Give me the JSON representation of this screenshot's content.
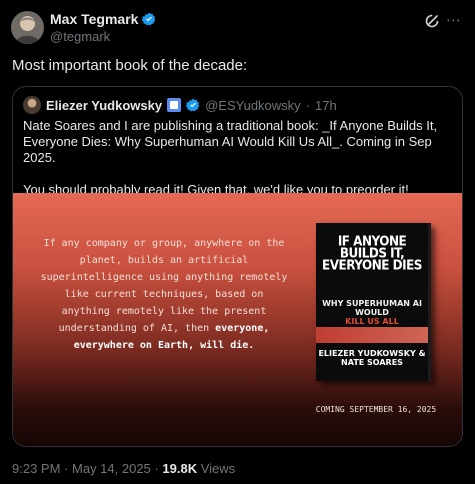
{
  "author": {
    "name": "Max Tegmark",
    "handle": "@tegmark"
  },
  "tweet_text": "Most important book of the decade:",
  "quoted": {
    "name": "Eliezer Yudkowsky",
    "handle": "@ESYudkowsky",
    "separator": "·",
    "time": "17h",
    "line1": "Nate Soares and I are publishing a traditional book:  _If Anyone Builds It, Everyone Dies: Why Superhuman AI Would Kill Us All_.  Coming in Sep 2025.",
    "line2": "You should probably read it!  Given that, we'd like you to preorder it!  Nowish!"
  },
  "image": {
    "quote_plain": "If any company or group, anywhere on the planet, builds an artificial superintelligence using anything remotely like current techniques, based on anything remotely like the present understanding of AI, then",
    "quote_bold": "everyone, everywhere on Earth, will die.",
    "book_title": "IF ANYONE BUILDS IT, EVERYONE DIES",
    "book_subtitle_a": "WHY SUPERHUMAN AI WOULD",
    "book_subtitle_b": "KILL US ALL",
    "book_authors": "ELIEZER YUDKOWSKY & NATE SOARES",
    "coming": "COMING SEPTEMBER 16, 2025"
  },
  "meta": {
    "time": "9:23 PM",
    "dot1": "·",
    "date": "May 14, 2025",
    "dot2": "·",
    "views_count": "19.8K",
    "views_label": "Views"
  },
  "colors": {
    "accent": "#1d9bf0",
    "muted": "#71767b",
    "text": "#e7e9ea"
  },
  "icons": [
    "verified-badge-icon",
    "grok-icon",
    "more-icon"
  ]
}
